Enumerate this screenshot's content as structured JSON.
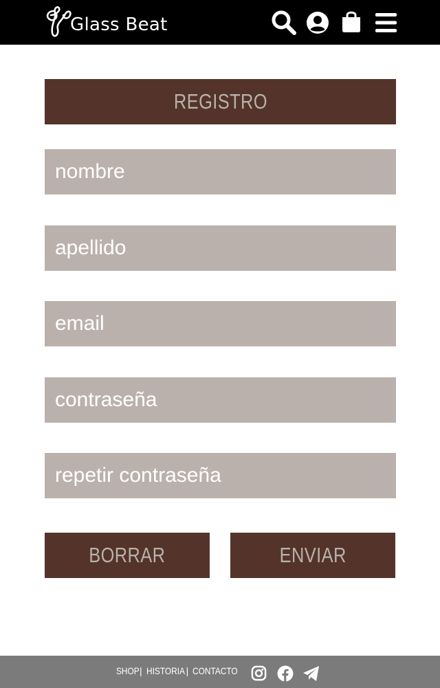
{
  "header": {
    "brand_name": "Glass Beat",
    "icons": [
      "search-icon",
      "user-icon",
      "shopping-bag-icon",
      "menu-icon"
    ]
  },
  "form": {
    "title": "REGISTRO",
    "fields": {
      "nombre": {
        "placeholder": "nombre",
        "value": ""
      },
      "apellido": {
        "placeholder": "apellido",
        "value": ""
      },
      "email": {
        "placeholder": "email",
        "value": ""
      },
      "password": {
        "placeholder": "contraseña",
        "value": ""
      },
      "repeat_password": {
        "placeholder": "repetir contraseña",
        "value": ""
      }
    },
    "buttons": {
      "reset_label": "BORRAR",
      "submit_label": "ENVIAR"
    }
  },
  "footer": {
    "nav": {
      "shop": "SHOP",
      "historia": "HISTORIA",
      "contacto": "CONTACTO",
      "separator": "|"
    },
    "social_icons": [
      "instagram-icon",
      "facebook-icon",
      "telegram-icon"
    ]
  },
  "colors": {
    "header_bg": "#000000",
    "accent_brown": "#54342a",
    "field_bg": "#bab1ad",
    "footer_bg": "#7b7b7b"
  }
}
